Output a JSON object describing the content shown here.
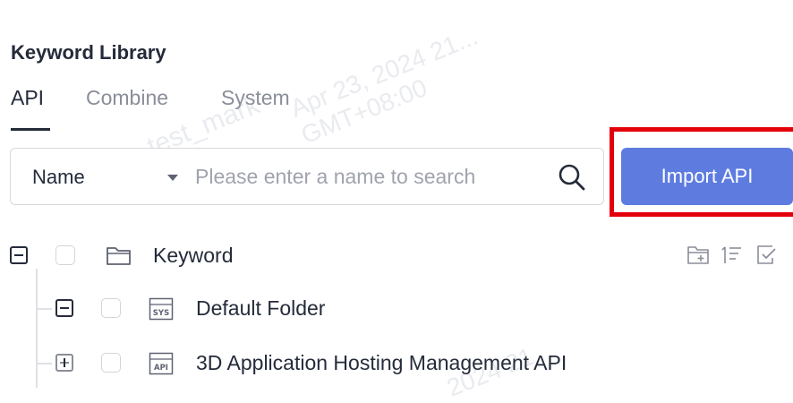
{
  "header": {
    "title": "Keyword Library"
  },
  "tabs": [
    {
      "label": "API",
      "active": true
    },
    {
      "label": "Combine",
      "active": false
    },
    {
      "label": "System",
      "active": false
    }
  ],
  "search": {
    "field_select": "Name",
    "placeholder": "Please enter a name to search",
    "value": ""
  },
  "toolbar": {
    "import_label": "Import API"
  },
  "tree": {
    "root": {
      "label": "Keyword",
      "expanded": true,
      "icon": "folder-icon"
    },
    "children": [
      {
        "label": "Default Folder",
        "expanded": true,
        "icon": "sys-badge-icon",
        "badge": "SYS"
      },
      {
        "label": "3D Application Hosting Management API",
        "expanded": false,
        "icon": "api-badge-icon",
        "badge": "API"
      }
    ],
    "actions": [
      "add-folder-icon",
      "sort-icon",
      "select-icon"
    ]
  },
  "colors": {
    "primary": "#5e7ce0",
    "highlight": "#e3000b",
    "text": "#252b3a",
    "muted": "#8a8e99"
  }
}
